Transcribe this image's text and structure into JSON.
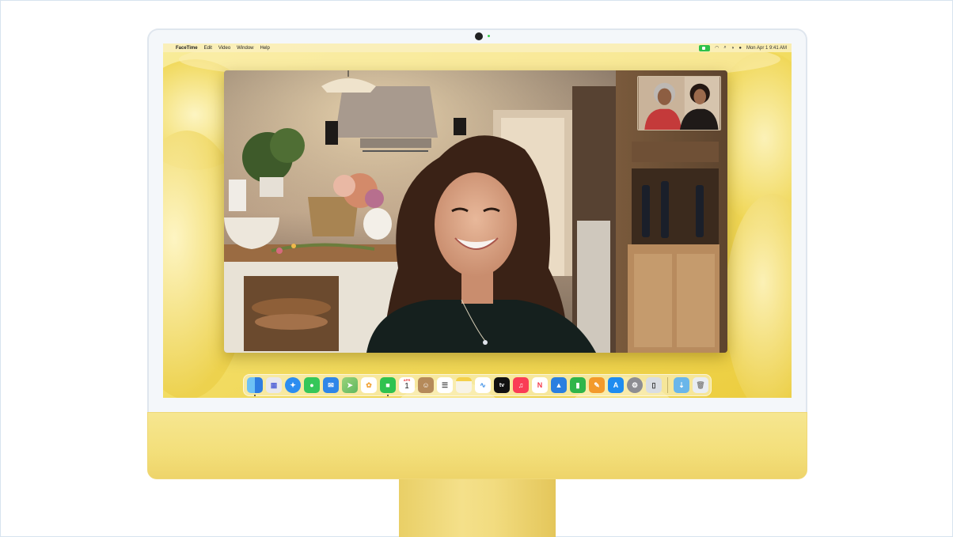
{
  "menubar": {
    "apple_glyph": "",
    "app_name": "FaceTime",
    "menus": [
      "Edit",
      "Video",
      "Window",
      "Help"
    ],
    "clock": "Mon Apr 1  9:41 AM"
  },
  "dock": {
    "apps": [
      {
        "name": "finder",
        "color": "#2f7de1",
        "running": true
      },
      {
        "name": "launchpad",
        "color": "#e8e8ee",
        "running": false
      },
      {
        "name": "safari",
        "color": "#2c8df0",
        "running": false
      },
      {
        "name": "messages",
        "color": "#35c759",
        "running": false
      },
      {
        "name": "mail",
        "color": "#2f86e8",
        "running": false
      },
      {
        "name": "maps",
        "color": "#5fb860",
        "running": false
      },
      {
        "name": "photos",
        "color": "#ffffff",
        "running": false
      },
      {
        "name": "facetime",
        "color": "#2fc24f",
        "running": true
      },
      {
        "name": "calendar",
        "color": "#ffffff",
        "running": false
      },
      {
        "name": "contacts",
        "color": "#b58a5a",
        "running": false
      },
      {
        "name": "reminders",
        "color": "#ffffff",
        "running": false
      },
      {
        "name": "notes",
        "color": "#f7f3e6",
        "running": false
      },
      {
        "name": "freeform",
        "color": "#ffffff",
        "running": false
      },
      {
        "name": "tv",
        "color": "#111111",
        "running": false
      },
      {
        "name": "music",
        "color": "#fa3c55",
        "running": false
      },
      {
        "name": "news",
        "color": "#ffffff",
        "running": false
      },
      {
        "name": "keynote",
        "color": "#2a7fe0",
        "running": false
      },
      {
        "name": "numbers",
        "color": "#2fb54a",
        "running": false
      },
      {
        "name": "pages",
        "color": "#f39a2b",
        "running": false
      },
      {
        "name": "app-store",
        "color": "#1f8cf0",
        "running": false
      },
      {
        "name": "system-settings",
        "color": "#8d8d92",
        "running": false
      },
      {
        "name": "iphone-mirroring",
        "color": "#d9dde3",
        "running": false
      }
    ],
    "calendar_month": "APR",
    "calendar_day": "1",
    "tv_label": "tv",
    "folder_color": "#6ab6ea",
    "trash_color": "#e9edf2"
  }
}
